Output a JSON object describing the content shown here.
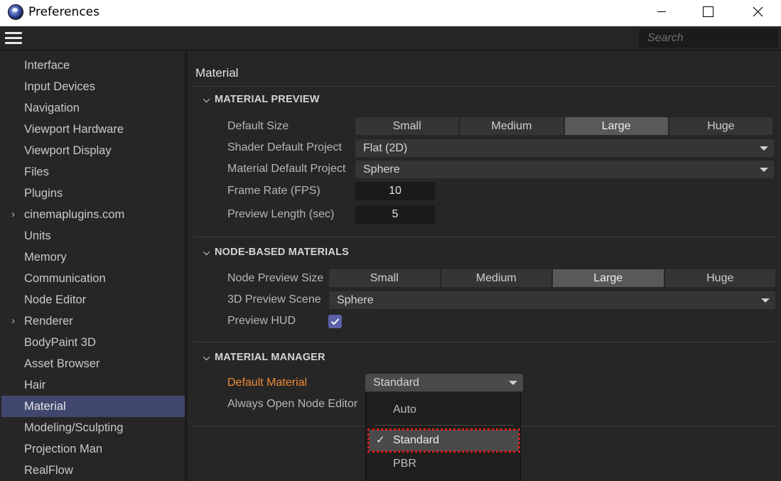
{
  "window": {
    "title": "Preferences"
  },
  "toolbar": {
    "search_placeholder": "Search"
  },
  "sidebar": {
    "items": [
      {
        "label": "Interface",
        "expandable": false
      },
      {
        "label": "Input Devices",
        "expandable": false
      },
      {
        "label": "Navigation",
        "expandable": false
      },
      {
        "label": "Viewport Hardware",
        "expandable": false
      },
      {
        "label": "Viewport Display",
        "expandable": false
      },
      {
        "label": "Files",
        "expandable": false
      },
      {
        "label": "Plugins",
        "expandable": false
      },
      {
        "label": "cinemaplugins.com",
        "expandable": true
      },
      {
        "label": "Units",
        "expandable": false
      },
      {
        "label": "Memory",
        "expandable": false
      },
      {
        "label": "Communication",
        "expandable": false
      },
      {
        "label": "Node Editor",
        "expandable": false
      },
      {
        "label": "Renderer",
        "expandable": true
      },
      {
        "label": "BodyPaint 3D",
        "expandable": false
      },
      {
        "label": "Asset Browser",
        "expandable": false
      },
      {
        "label": "Hair",
        "expandable": false
      },
      {
        "label": "Material",
        "expandable": false,
        "active": true
      },
      {
        "label": "Modeling/Sculpting",
        "expandable": false
      },
      {
        "label": "Projection Man",
        "expandable": false
      },
      {
        "label": "RealFlow",
        "expandable": false
      }
    ]
  },
  "main": {
    "title": "Material",
    "material_preview": {
      "heading": "MATERIAL PREVIEW",
      "default_size_label": "Default Size",
      "size_options": [
        "Small",
        "Medium",
        "Large",
        "Huge"
      ],
      "size_selected": "Large",
      "shader_project_label": "Shader Default Project",
      "shader_project_value": "Flat (2D)",
      "material_project_label": "Material Default Project",
      "material_project_value": "Sphere",
      "frame_rate_label": "Frame Rate (FPS)",
      "frame_rate_value": "10",
      "preview_length_label": "Preview Length (sec)",
      "preview_length_value": "5"
    },
    "node_materials": {
      "heading": "NODE-BASED MATERIALS",
      "preview_size_label": "Node Preview Size",
      "size_options": [
        "Small",
        "Medium",
        "Large",
        "Huge"
      ],
      "size_selected": "Large",
      "scene_label": "3D Preview Scene",
      "scene_value": "Sphere",
      "hud_label": "Preview HUD",
      "hud_checked": true
    },
    "material_manager": {
      "heading": "MATERIAL MANAGER",
      "default_material_label": "Default Material",
      "default_material_value": "Standard",
      "node_editor_label": "Always Open Node Editor"
    }
  },
  "popup": {
    "options": [
      "Auto",
      "Standard",
      "PBR"
    ],
    "selected": "Standard"
  },
  "colors": {
    "accent_selection": "#40476e",
    "highlight_label": "#f08a33",
    "checkbox": "#5b62a8",
    "focus_outline": "#e11d1d"
  }
}
